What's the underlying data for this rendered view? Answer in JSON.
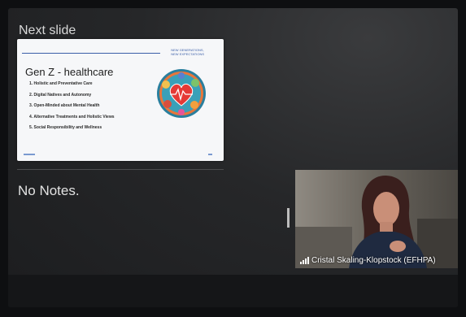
{
  "presenter": {
    "next_slide_label": "Next slide",
    "notes_text": "No Notes."
  },
  "slide": {
    "corner_text_1": "NEW GENERATIONS,",
    "corner_text_2": "NEW EXPECTATIONS",
    "title": "Gen Z - healthcare",
    "items": [
      "1. Holistic and Preventative Care",
      "2. Digital Natives and Autonomy",
      "3. Open-Minded about Mental Health",
      "4. Alternative Treatments and Holistic Views",
      "5. Social Responsibility and Wellness"
    ]
  },
  "video": {
    "participant_name": "Cristal Skaling-Klopstock (EFHPA)"
  },
  "icons": {
    "signal": "signal-bars-icon",
    "slide_art": "heart-rate-illustration-icon"
  },
  "colors": {
    "slide_accent": "#3a5ea8",
    "background": "#262729"
  }
}
